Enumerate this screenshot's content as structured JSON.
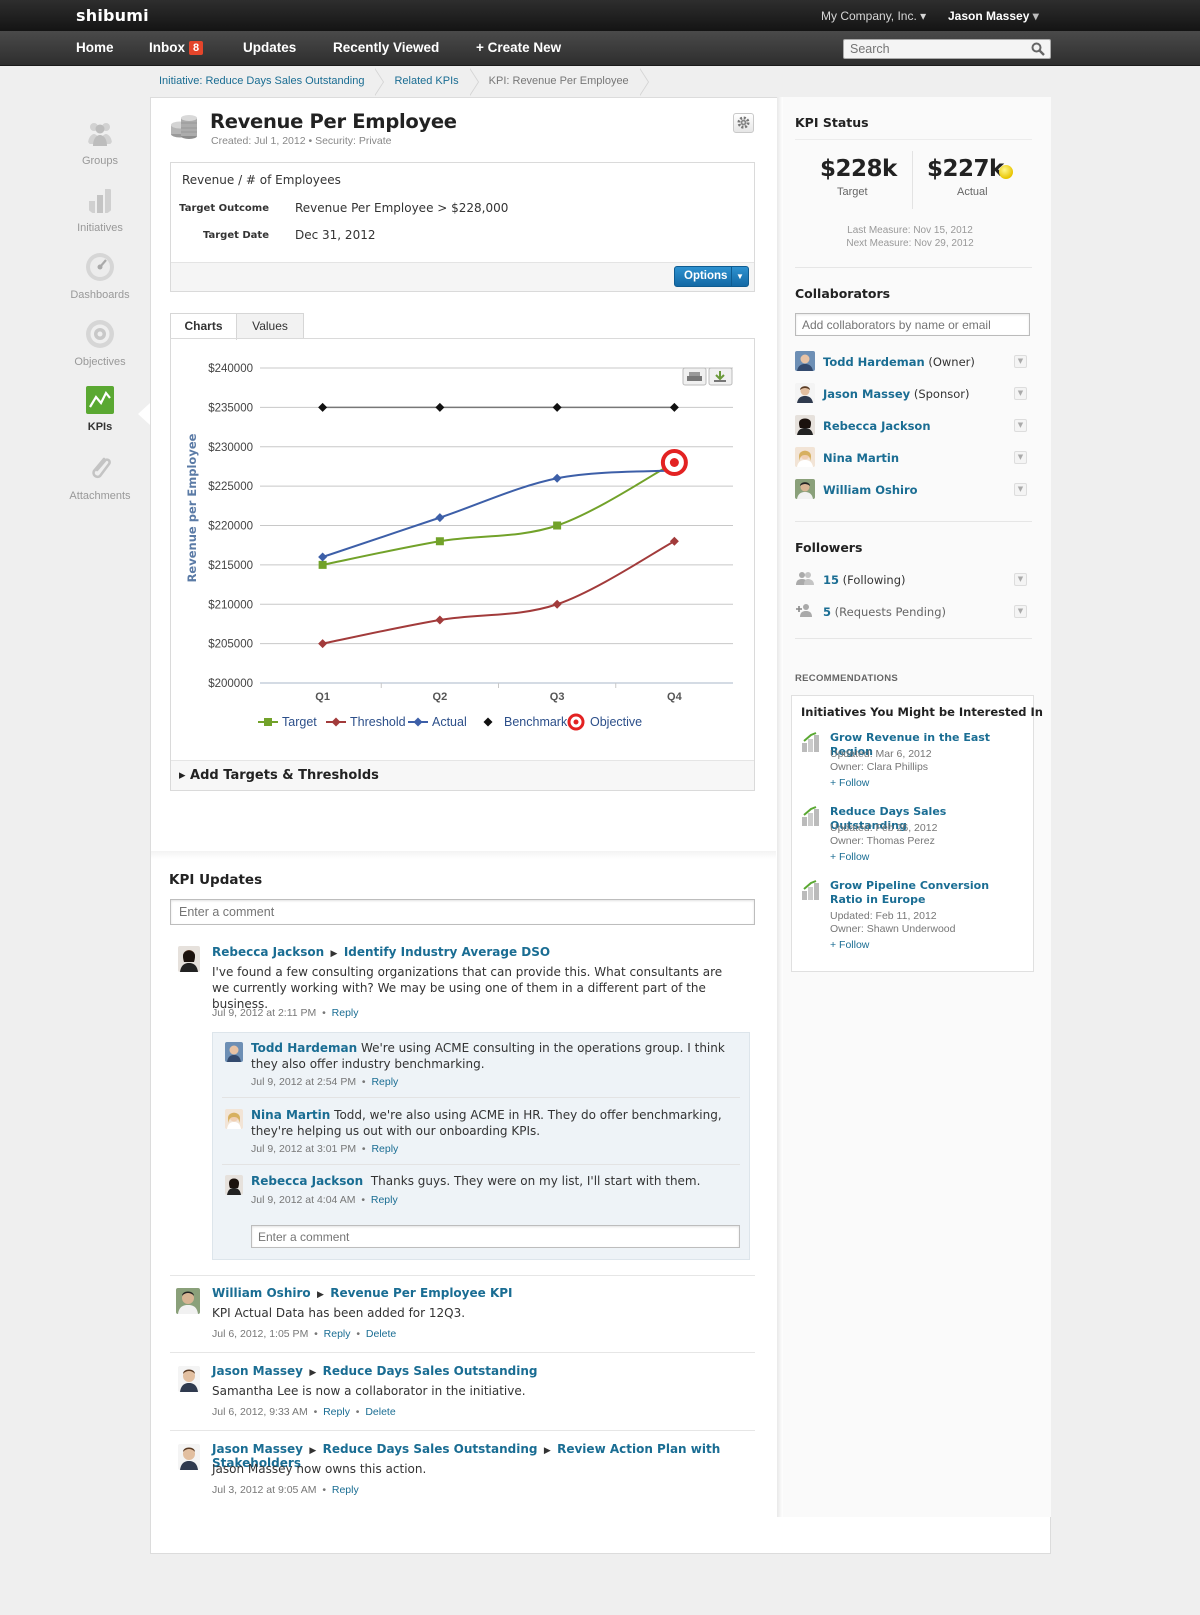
{
  "app": {
    "logo": "shibumi",
    "company": "My Company, Inc.",
    "user": "Jason Massey",
    "dropdown_glyph": "▾"
  },
  "nav": {
    "items": [
      {
        "label": "Home"
      },
      {
        "label": "Inbox",
        "badge": "8"
      },
      {
        "label": "Updates"
      },
      {
        "label": "Recently Viewed"
      },
      {
        "label": "+ Create New"
      }
    ],
    "search_placeholder": "Search"
  },
  "breadcrumbs": [
    "Initiative: Reduce Days Sales Outstanding",
    "Related KPIs",
    "KPI: Revenue Per Employee"
  ],
  "sidebar": [
    {
      "label": "Groups",
      "icon": "groups-icon"
    },
    {
      "label": "Initiatives",
      "icon": "initiatives-icon"
    },
    {
      "label": "Dashboards",
      "icon": "dashboards-icon"
    },
    {
      "label": "Objectives",
      "icon": "objectives-icon"
    },
    {
      "label": "KPIs",
      "icon": "kpis-icon",
      "active": true
    },
    {
      "label": "Attachments",
      "icon": "paperclip-icon"
    }
  ],
  "kpi": {
    "title": "Revenue Per Employee",
    "meta": "Created: Jul 1, 2012  •  Security: Private",
    "formula": "Revenue / # of Employees",
    "target_outcome_label": "Target Outcome",
    "target_outcome": "Revenue Per Employee > $228,000",
    "target_date_label": "Target Date",
    "target_date": "Dec 31, 2012",
    "options_label": "Options"
  },
  "tabs": [
    "Charts",
    "Values"
  ],
  "add_targets": "▸ Add Targets & Thresholds",
  "chart_data": {
    "type": "line",
    "categories": [
      "Q1",
      "Q2",
      "Q3",
      "Q4"
    ],
    "ylabel": "Revenue per Employee",
    "ylim": [
      200000,
      240000
    ],
    "yticks": [
      240000,
      235000,
      230000,
      225000,
      220000,
      215000,
      210000,
      205000,
      200000
    ],
    "ytick_labels": [
      "$240000",
      "$235000",
      "$230000",
      "$225000",
      "$220000",
      "$215000",
      "$210000",
      "$205000",
      "$200000"
    ],
    "series": [
      {
        "name": "Target",
        "color": "#72a22a",
        "marker": "square",
        "values": [
          215000,
          218000,
          220000,
          228000
        ]
      },
      {
        "name": "Threshold",
        "color": "#a23b3b",
        "marker": "diamond",
        "values": [
          205000,
          208000,
          210000,
          218000
        ]
      },
      {
        "name": "Actual",
        "color": "#3d5fa8",
        "marker": "diamond",
        "values": [
          216000,
          221000,
          226000,
          227000
        ]
      },
      {
        "name": "Benchmark",
        "color": "#111111",
        "marker": "diamond",
        "values": [
          235000,
          235000,
          235000,
          235000
        ]
      }
    ],
    "objective": {
      "name": "Objective",
      "color": "#e32222",
      "category": "Q4",
      "value": 228000
    },
    "legend": "bottom",
    "grid": true
  },
  "updates": {
    "title": "KPI Updates",
    "comment_placeholder": "Enter a comment",
    "threads": [
      {
        "author": "Rebecca Jackson",
        "links": [
          "Identify Industry Average DSO"
        ],
        "text": "I've found a few consulting organizations that can provide this. What consultants are we currently working with? We may be using one of them in a different part of the business.",
        "time": "Jul 9, 2012 at 2:11 PM",
        "actions": [
          "Reply"
        ],
        "replies": [
          {
            "author": "Todd Hardeman",
            "text": "We're using ACME consulting in the operations group. I think they also offer industry benchmarking.",
            "time": "Jul 9, 2012 at 2:54 PM",
            "action": "Reply"
          },
          {
            "author": "Nina Martin",
            "text": "Todd, we're also using ACME in HR. They do offer benchmarking, they're helping us out with our onboarding KPIs.",
            "time": "Jul 9, 2012 at 3:01 PM",
            "action": "Reply"
          },
          {
            "author": "Rebecca Jackson",
            "text": "Thanks guys. They were on my list, I'll start with them.",
            "time": "Jul 9, 2012 at 4:04 AM",
            "action": "Reply"
          }
        ],
        "reply_placeholder": "Enter a comment"
      },
      {
        "author": "William Oshiro",
        "links": [
          "Revenue Per Employee KPI"
        ],
        "text": "KPI Actual Data has been added for 12Q3.",
        "time": "Jul 6, 2012, 1:05 PM",
        "actions": [
          "Reply",
          "Delete"
        ]
      },
      {
        "author": "Jason Massey",
        "links": [
          "Reduce Days Sales Outstanding"
        ],
        "text": "Samantha Lee is now a collaborator in the initiative.",
        "time": "Jul 6, 2012, 9:33 AM",
        "actions": [
          "Reply",
          "Delete"
        ]
      },
      {
        "author": "Jason Massey",
        "links": [
          "Reduce Days Sales Outstanding",
          "Review Action Plan with Stakeholders"
        ],
        "text": "Jason Massey now owns this action.",
        "time": "Jul 3, 2012 at 9:05 AM",
        "actions": [
          "Reply"
        ]
      }
    ]
  },
  "status": {
    "title": "KPI Status",
    "target_value": "$228k",
    "target_label": "Target",
    "actual_value": "$227k",
    "actual_label": "Actual",
    "status_color": "#e8c400",
    "last_measure": "Last Measure: Nov 15, 2012",
    "next_measure": "Next Measure: Nov 29, 2012"
  },
  "collaborators": {
    "title": "Collaborators",
    "placeholder": "Add collaborators by name or email",
    "people": [
      {
        "name": "Todd Hardeman",
        "role": " (Owner)"
      },
      {
        "name": "Jason Massey",
        "role": " (Sponsor)"
      },
      {
        "name": "Rebecca Jackson",
        "role": ""
      },
      {
        "name": "Nina Martin",
        "role": ""
      },
      {
        "name": "William Oshiro",
        "role": ""
      }
    ]
  },
  "followers": {
    "title": "Followers",
    "rows": [
      {
        "count": "15",
        "label": " (Following)"
      },
      {
        "count": "5",
        "label": " (Requests Pending)"
      }
    ]
  },
  "recommendations": {
    "header": "RECOMMENDATIONS",
    "title": "Initiatives You Might be Interested In",
    "items": [
      {
        "title": "Grow Revenue in the East Region",
        "updated": "Updated: Mar 6, 2012",
        "owner": "Owner: Clara Phillips",
        "follow": "+ Follow"
      },
      {
        "title": "Reduce Days Sales Outstanding",
        "updated": "Updated: Feb 26, 2012",
        "owner": "Owner: Thomas Perez",
        "follow": "+ Follow"
      },
      {
        "title": "Grow Pipeline Conversion Ratio in Europe",
        "updated": "Updated: Feb 11, 2012",
        "owner": "Owner: Shawn Underwood",
        "follow": "+ Follow"
      }
    ]
  }
}
